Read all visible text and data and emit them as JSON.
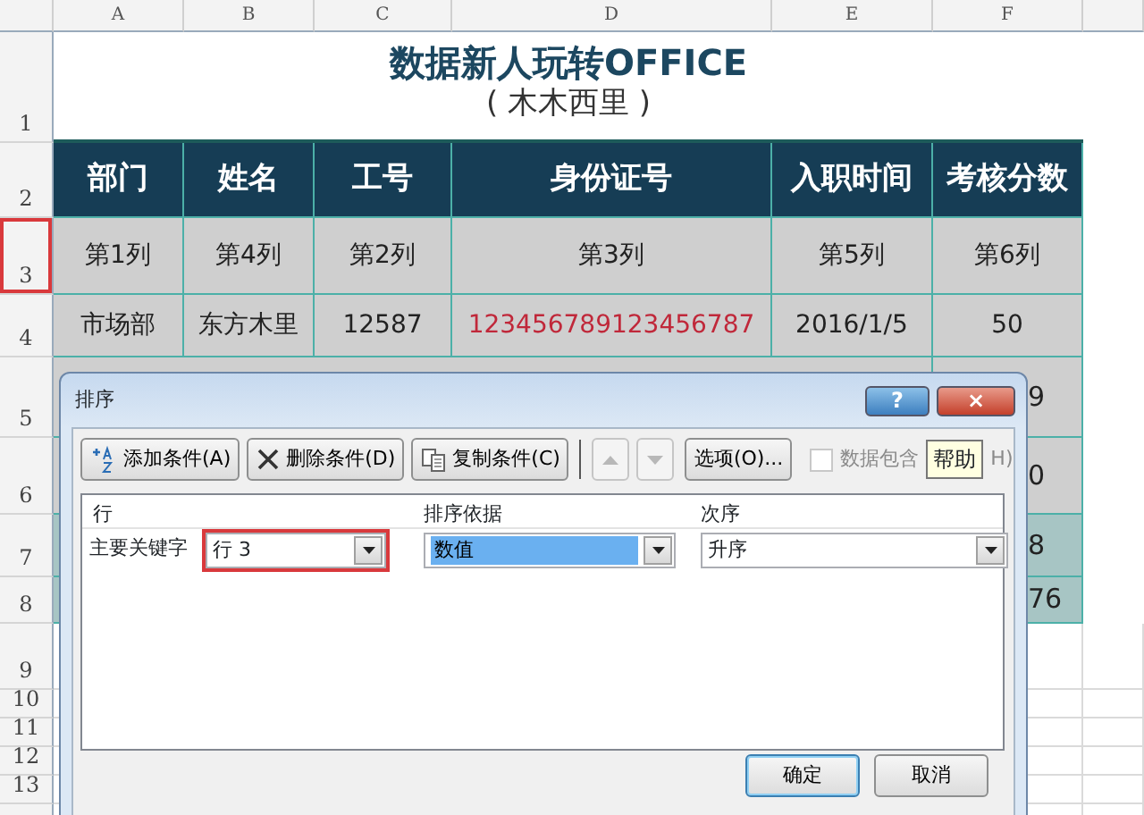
{
  "sheet": {
    "columns": [
      "A",
      "B",
      "C",
      "D",
      "E",
      "F"
    ],
    "rows": [
      {
        "number": "1",
        "highlighted": false
      },
      {
        "number": "2",
        "highlighted": false
      },
      {
        "number": "3",
        "highlighted": true
      },
      {
        "number": "4",
        "highlighted": false
      },
      {
        "number": "5",
        "highlighted": false
      },
      {
        "number": "6",
        "highlighted": false
      },
      {
        "number": "7",
        "highlighted": false
      },
      {
        "number": "8",
        "highlighted": false
      },
      {
        "number": "9",
        "highlighted": false
      },
      {
        "number": "10",
        "highlighted": false
      },
      {
        "number": "11",
        "highlighted": false
      },
      {
        "number": "12",
        "highlighted": false
      },
      {
        "number": "13",
        "highlighted": false
      }
    ]
  },
  "table": {
    "title": "数据新人玩转OFFICE",
    "subtitle": "( 木木西里 )",
    "headers": [
      "部门",
      "姓名",
      "工号",
      "身份证号",
      "入职时间",
      "考核分数"
    ],
    "rows": [
      {
        "cells": [
          {
            "text": "第1列"
          },
          {
            "text": "第4列"
          },
          {
            "text": "第2列"
          },
          {
            "text": "第3列"
          },
          {
            "text": "第5列"
          },
          {
            "text": "第6列"
          }
        ]
      },
      {
        "cells": [
          {
            "text": "市场部"
          },
          {
            "text": "东方木里"
          },
          {
            "text": "12587"
          },
          {
            "text": "123456789123456787",
            "color": "#c0283a"
          },
          {
            "text": "2016/1/5"
          },
          {
            "text": "50"
          }
        ]
      }
    ],
    "partial_rows": [
      {
        "text": "9",
        "selected": false
      },
      {
        "text": "0",
        "selected": false
      },
      {
        "text": "8",
        "selected": true
      },
      {
        "text": "76",
        "selected": true
      }
    ]
  },
  "dialog": {
    "title": "排序",
    "title_buttons": [
      {
        "label": "?",
        "kind": "help"
      },
      {
        "label": "×",
        "kind": "close"
      }
    ],
    "toolbar": [
      {
        "kind": "button",
        "label": "添加条件(A)"
      },
      {
        "kind": "button",
        "label": "删除条件(D)"
      },
      {
        "kind": "button",
        "label": "复制条件(C)"
      },
      {
        "kind": "up",
        "disabled": true
      },
      {
        "kind": "down",
        "disabled": true
      },
      {
        "kind": "button",
        "label": "选项(O)..."
      }
    ],
    "header_checkbox": {
      "label": "数据包含",
      "label_tail": "H)",
      "checked": false,
      "disabled": true
    },
    "tooltip": "帮助",
    "columns": [
      "行",
      "排序依据",
      "次序"
    ],
    "levels": [
      {
        "label": "主要关键字",
        "key": {
          "value": "行 3",
          "highlighted": true
        },
        "sort_on": {
          "value": "数值",
          "selected": true
        },
        "order": {
          "value": "升序",
          "selected": false
        }
      }
    ],
    "buttons": [
      {
        "label": "确定",
        "default": true
      },
      {
        "label": "取消",
        "default": false
      }
    ]
  }
}
